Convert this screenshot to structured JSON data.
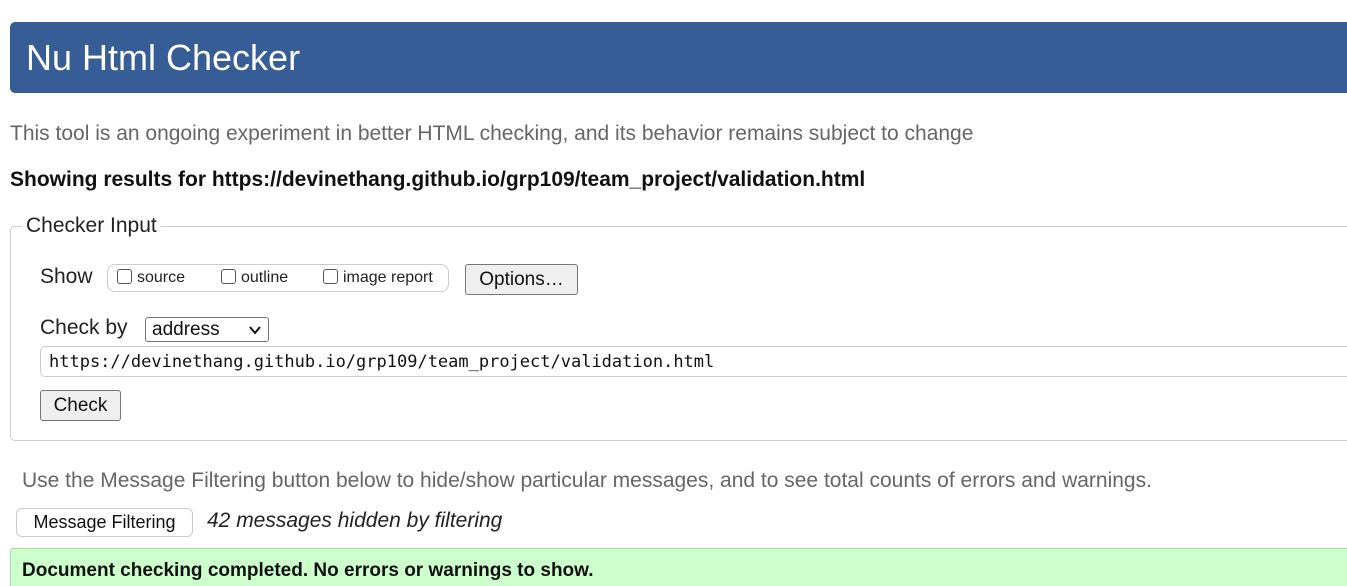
{
  "header": {
    "title": "Nu Html Checker",
    "banner_color": "#365d95"
  },
  "tagline": "This tool is an ongoing experiment in better HTML checking, and its behavior remains subject to change",
  "results_heading": "Showing results for https://devinethang.github.io/grp109/team_project/validation.html",
  "checker_input": {
    "legend": "Checker Input",
    "show_label": "Show",
    "show_options": [
      {
        "label": "source",
        "checked": false
      },
      {
        "label": "outline",
        "checked": false
      },
      {
        "label": "image report",
        "checked": false
      }
    ],
    "options_button": "Options…",
    "check_by_label": "Check by",
    "check_by_selected": "address",
    "url_value": "https://devinethang.github.io/grp109/team_project/validation.html",
    "check_button": "Check"
  },
  "filtering": {
    "info": "Use the Message Filtering button below to hide/show particular messages, and to see total counts of errors and warnings.",
    "button": "Message Filtering",
    "hidden_count": "42 messages hidden by filtering"
  },
  "success": {
    "message": "Document checking completed. No errors or warnings to show.",
    "color": "#ccffcc"
  }
}
